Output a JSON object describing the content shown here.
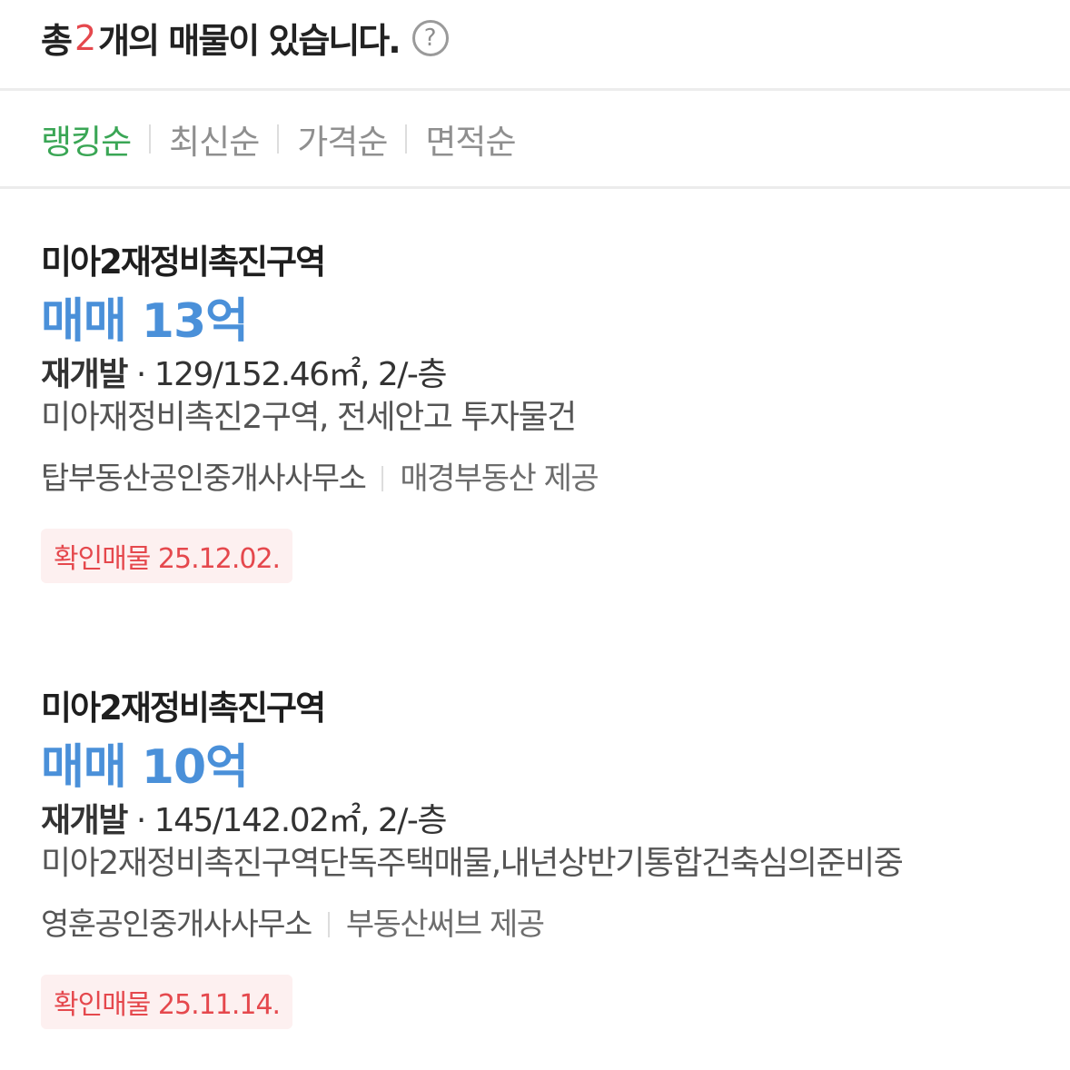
{
  "header": {
    "prefix": "총",
    "count": "2",
    "suffix": "개의 매물이 있습니다.",
    "help_icon": "?"
  },
  "sort": {
    "items": [
      {
        "label": "랭킹순",
        "active": true
      },
      {
        "label": "최신순",
        "active": false
      },
      {
        "label": "가격순",
        "active": false
      },
      {
        "label": "면적순",
        "active": false
      }
    ]
  },
  "listings": [
    {
      "title": "미아2재정비촉진구역",
      "price": "매매 13억",
      "type": "재개발",
      "specs": " · 129/152.46㎡, 2/-층",
      "description": "미아재정비촉진2구역, 전세안고 투자물건",
      "agent": "탑부동산공인중개사사무소",
      "provider": "매경부동산 제공",
      "badge": "확인매물 25.12.02."
    },
    {
      "title": "미아2재정비촉진구역",
      "price": "매매 10억",
      "type": "재개발",
      "specs": " · 145/142.02㎡, 2/-층",
      "description": "미아2재정비촉진구역단독주택매물,내년상반기통합건축심의준비중",
      "agent": "영훈공인중개사사무소",
      "provider": "부동산써브 제공",
      "badge": "확인매물 25.11.14."
    }
  ],
  "colors": {
    "count": "#e5484d",
    "active_sort": "#3aa655",
    "price": "#4a90d9",
    "badge_text": "#e5484d",
    "badge_bg": "#fdf0f0"
  }
}
